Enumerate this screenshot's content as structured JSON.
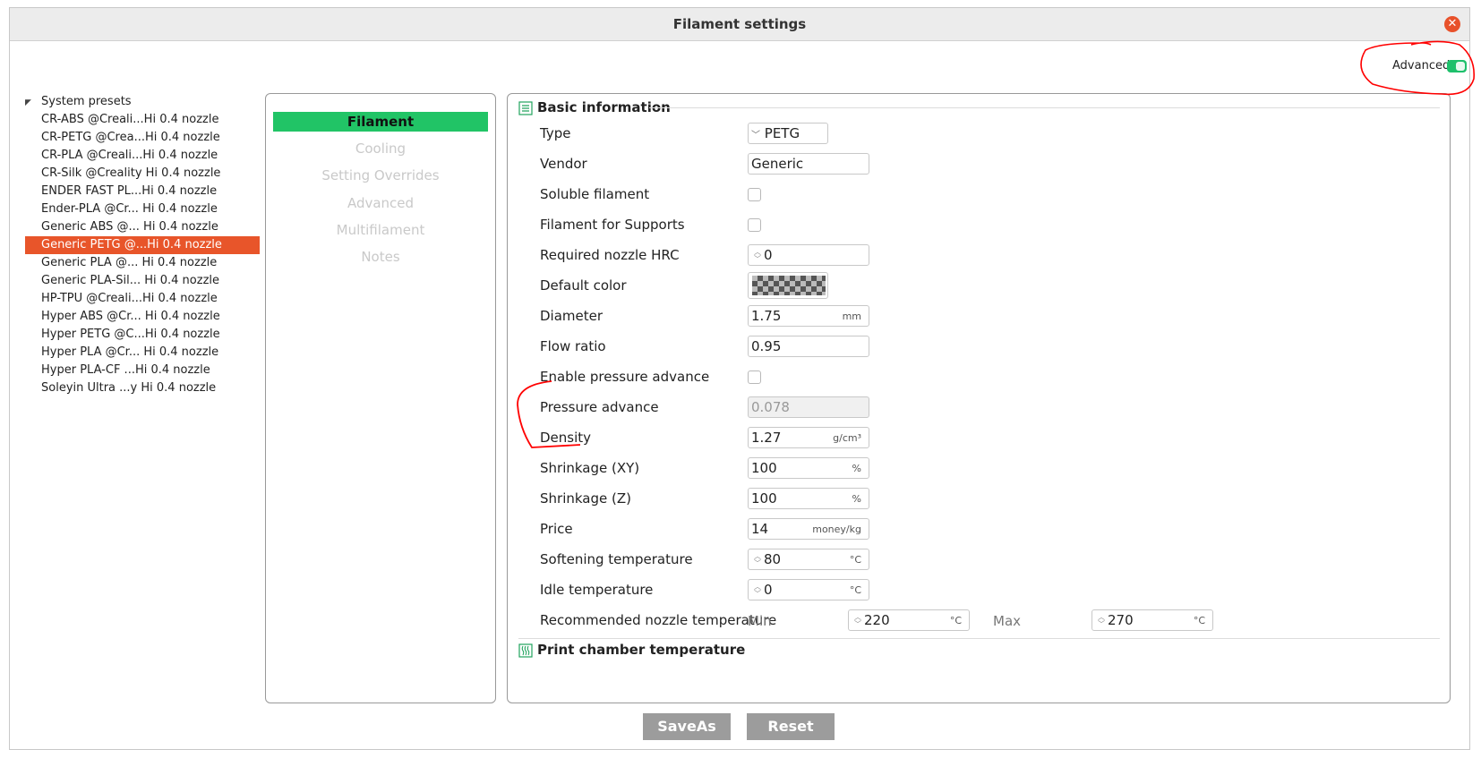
{
  "window": {
    "title": "Filament settings"
  },
  "advanced_toggle": {
    "label": "Advanced",
    "on": true
  },
  "tree": {
    "root_label": "System presets",
    "presets": [
      "CR-ABS @Creali...Hi 0.4 nozzle",
      "CR-PETG @Crea...Hi 0.4 nozzle",
      "CR-PLA @Creali...Hi 0.4 nozzle",
      "CR-Silk @Creality Hi 0.4 nozzle",
      "ENDER FAST PL...Hi 0.4 nozzle",
      "Ender-PLA @Cr... Hi 0.4 nozzle",
      "Generic ABS @... Hi 0.4 nozzle",
      "Generic PETG @...Hi 0.4 nozzle",
      "Generic PLA @... Hi 0.4 nozzle",
      "Generic PLA-Sil... Hi 0.4 nozzle",
      "HP-TPU @Creali...Hi 0.4 nozzle",
      "Hyper ABS @Cr... Hi 0.4 nozzle",
      "Hyper PETG @C...Hi 0.4 nozzle",
      "Hyper PLA @Cr... Hi 0.4 nozzle",
      "Hyper PLA-CF ...Hi 0.4 nozzle",
      "Soleyin Ultra ...y Hi 0.4 nozzle"
    ],
    "selected_index": 7
  },
  "nav": {
    "items": [
      "Filament",
      "Cooling",
      "Setting Overrides",
      "Advanced",
      "Multifilament",
      "Notes"
    ],
    "active_index": 0
  },
  "basic": {
    "section_title": "Basic information",
    "type_label": "Type",
    "type_value": "PETG",
    "vendor_label": "Vendor",
    "vendor_value": "Generic",
    "soluble_label": "Soluble filament",
    "supports_label": "Filament for Supports",
    "hrc_label": "Required nozzle HRC",
    "hrc_value": "0",
    "color_label": "Default color",
    "diameter_label": "Diameter",
    "diameter_value": "1.75",
    "diameter_unit": "mm",
    "flow_label": "Flow ratio",
    "flow_value": "0.95",
    "epa_label": "Enable pressure advance",
    "pa_label": "Pressure advance",
    "pa_value": "0.078",
    "density_label": "Density",
    "density_value": "1.27",
    "density_unit": "g/cm³",
    "shrink_xy_label": "Shrinkage (XY)",
    "shrink_xy_value": "100",
    "shrink_xy_unit": "%",
    "shrink_z_label": "Shrinkage (Z)",
    "shrink_z_value": "100",
    "shrink_z_unit": "%",
    "price_label": "Price",
    "price_value": "14",
    "price_unit": "money/kg",
    "soft_label": "Softening temperature",
    "soft_value": "80",
    "soft_unit": "°C",
    "idle_label": "Idle temperature",
    "idle_value": "0",
    "idle_unit": "°C",
    "rec_label": "Recommended nozzle temperature",
    "min_label": "Min",
    "min_value": "220",
    "min_unit": "°C",
    "max_label": "Max",
    "max_value": "270",
    "max_unit": "°C"
  },
  "chamber": {
    "section_title": "Print chamber temperature"
  },
  "buttons": {
    "save_as": "SaveAs",
    "reset": "Reset"
  },
  "colors": {
    "accent_green": "#21c466",
    "selected_orange": "#e8552a",
    "annotation_red": "#ff0000"
  }
}
